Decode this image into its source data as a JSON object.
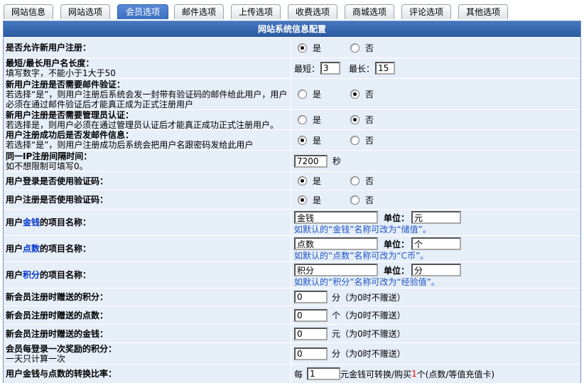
{
  "colors": {
    "tab_active": "#3b6fc2",
    "header": "#2a5a9f",
    "row_bg": "#e6eef8",
    "border": "#6f93c8",
    "highlight_text": "#0033cc",
    "hint_text": "#1f55c7",
    "emphasis_text": "#ff0000"
  },
  "tabs": [
    {
      "label": "网站信息",
      "active": false
    },
    {
      "label": "网站选项",
      "active": false
    },
    {
      "label": "会员选项",
      "active": true
    },
    {
      "label": "邮件选项",
      "active": false
    },
    {
      "label": "上传选项",
      "active": false
    },
    {
      "label": "收费选项",
      "active": false
    },
    {
      "label": "商城选项",
      "active": false
    },
    {
      "label": "评论选项",
      "active": false
    },
    {
      "label": "其他选项",
      "active": false
    }
  ],
  "panel": {
    "title": "网站系统信息配置"
  },
  "choice": {
    "yes": "是",
    "no": "否"
  },
  "settings": {
    "allow_register": {
      "label": "是否允许新用户注册：",
      "enabled": true
    },
    "username_length": {
      "label": "最短/最长用户名长度：",
      "hint": "填写数字，不能小于1大于50",
      "min_label": "最短：",
      "min_value": "3",
      "max_label": "最长：",
      "max_value": "15"
    },
    "email_verify": {
      "label": "新用户注册是否需要邮件验证：",
      "hint": "若选择“是”，则用户注册后系统会发一封带有验证码的邮件给此用户，用户必须在通过邮件验证后才能真正成为正式注册用户",
      "enabled": false
    },
    "admin_verify": {
      "label": "新用户注册是否需要管理员认证：",
      "hint": "若选择是，则用户必须在通过管理员认证后才能真正成功正式注册用户。",
      "enabled": false
    },
    "welcome_mail": {
      "label": "用户注册成功后是否发邮件信息：",
      "hint": "若选择“是”，则用户注册成功后系统会把用户名跟密码发给此用户",
      "enabled": true
    },
    "ip_interval": {
      "label": "同一IP注册间隔时间：",
      "hint": "如不想限制可填写0。",
      "value": "7200",
      "unit": "秒"
    },
    "login_captcha": {
      "label": "用户登录是否使用验证码：",
      "enabled": true
    },
    "register_captcha": {
      "label": "用户注册是否使用验证码：",
      "enabled": true
    },
    "money_name": {
      "label_prefix": "用户",
      "label_em": "金钱",
      "label_suffix": "的项目名称：",
      "value": "金钱",
      "unit_label": "单位：",
      "unit": "元",
      "hint": "如默认的“金钱”名称可改为“储值”。"
    },
    "point_name": {
      "label_prefix": "用户",
      "label_em": "点数",
      "label_suffix": "的项目名称：",
      "value": "点数",
      "unit_label": "单位：",
      "unit": "个",
      "hint": "如默认的“点数”名称可改为“C币”。"
    },
    "score_name": {
      "label_prefix": "用户",
      "label_em": "积分",
      "label_suffix": "的项目名称：",
      "value": "积分",
      "unit_label": "单位：",
      "unit": "分",
      "hint": "如默认的“积分”名称可改为“经验值”。"
    },
    "register_score": {
      "label": "新会员注册时赠送的积分：",
      "value": "0",
      "suffix": "分（为0时不赠送）"
    },
    "register_points": {
      "label": "新会员注册时赠送的点数：",
      "value": "0",
      "suffix": "个（为0时不赠送）"
    },
    "register_money": {
      "label": "新会员注册时赠送的金钱：",
      "value": "0",
      "suffix": "元（为0时不赠送）"
    },
    "login_reward": {
      "label": "会员每登录一次奖励的积分：",
      "hint": "一天只计算一次",
      "value": "0",
      "suffix": "分（为0时不赠送）"
    },
    "exchange_rate": {
      "label": "用户金钱与点数的转换比率：",
      "prefix": "每",
      "value": "1",
      "middle": "元金钱可转换/购买",
      "points": "1",
      "suffix": "个(点数/等值充值卡)"
    }
  }
}
